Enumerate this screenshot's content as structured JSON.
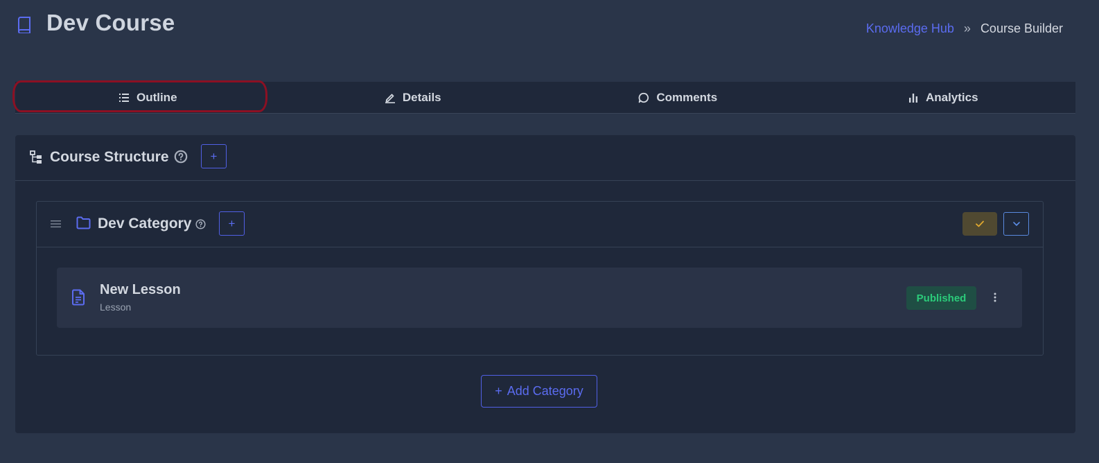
{
  "header": {
    "title": "Dev Course",
    "icon": "book-icon"
  },
  "breadcrumb": {
    "items": [
      {
        "label": "Knowledge Hub",
        "link": true
      },
      {
        "label": "Course Builder",
        "link": false
      }
    ],
    "separator": "»"
  },
  "tabs": [
    {
      "label": "Outline",
      "icon": "list-icon",
      "active": true
    },
    {
      "label": "Details",
      "icon": "pencil-icon",
      "active": false
    },
    {
      "label": "Comments",
      "icon": "comment-icon",
      "active": false
    },
    {
      "label": "Analytics",
      "icon": "bar-chart-icon",
      "active": false
    }
  ],
  "structure": {
    "title": "Course Structure",
    "add_label": "+",
    "category": {
      "title": "Dev Category",
      "add_label": "+",
      "lesson": {
        "title": "New Lesson",
        "subtitle": "Lesson",
        "status": "Published"
      }
    },
    "add_category_icon": "+",
    "add_category_label": "Add Category"
  },
  "colors": {
    "background": "#2a3549",
    "panel": "#1f283a",
    "accent": "#5b6cf0",
    "status_green": "#2bcb7a",
    "status_bg": "#1f4e44",
    "warning": "#e0a82e",
    "highlight_outline": "#8c1023"
  }
}
